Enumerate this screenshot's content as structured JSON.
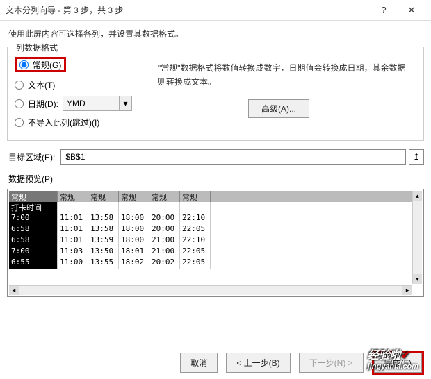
{
  "titlebar": {
    "title": "文本分列向导 - 第 3 步，共 3 步",
    "help": "?",
    "close": "✕"
  },
  "instruction": "使用此屏内容可选择各列，并设置其数据格式。",
  "format_group": {
    "legend": "列数据格式",
    "general": "常规(G)",
    "text": "文本(T)",
    "date": "日期(D):",
    "date_value": "YMD",
    "skip": "不导入此列(跳过)(I)"
  },
  "desc": "\"常规\"数据格式将数值转换成数字，日期值会转换成日期，其余数据则转换成文本。",
  "advanced_btn": "高级(A)...",
  "dest": {
    "label": "目标区域(E):",
    "value": "$B$1"
  },
  "preview": {
    "label": "数据预览(P)",
    "headers": [
      "常规",
      "常规",
      "常规",
      "常规",
      "常规",
      "常规"
    ],
    "row_header": "打卡时间",
    "rows": [
      [
        "7:00",
        "11:01",
        "13:58",
        "18:00",
        "20:00",
        "22:10"
      ],
      [
        "6:58",
        "11:01",
        "13:58",
        "18:00",
        "20:00",
        "22:05"
      ],
      [
        "6:58",
        "11:01",
        "13:59",
        "18:00",
        "21:00",
        "22:10"
      ],
      [
        "7:00",
        "11:03",
        "13:50",
        "18:01",
        "21:00",
        "22:05"
      ],
      [
        "6:55",
        "11:00",
        "13:55",
        "18:02",
        "20:02",
        "22:05"
      ]
    ]
  },
  "footer": {
    "cancel": "取消",
    "back": "< 上一步(B)",
    "next": "下一步(N) >",
    "finish": "完成(F)"
  },
  "watermark": {
    "brand": "经验啦",
    "url": "jingyanla.com"
  }
}
